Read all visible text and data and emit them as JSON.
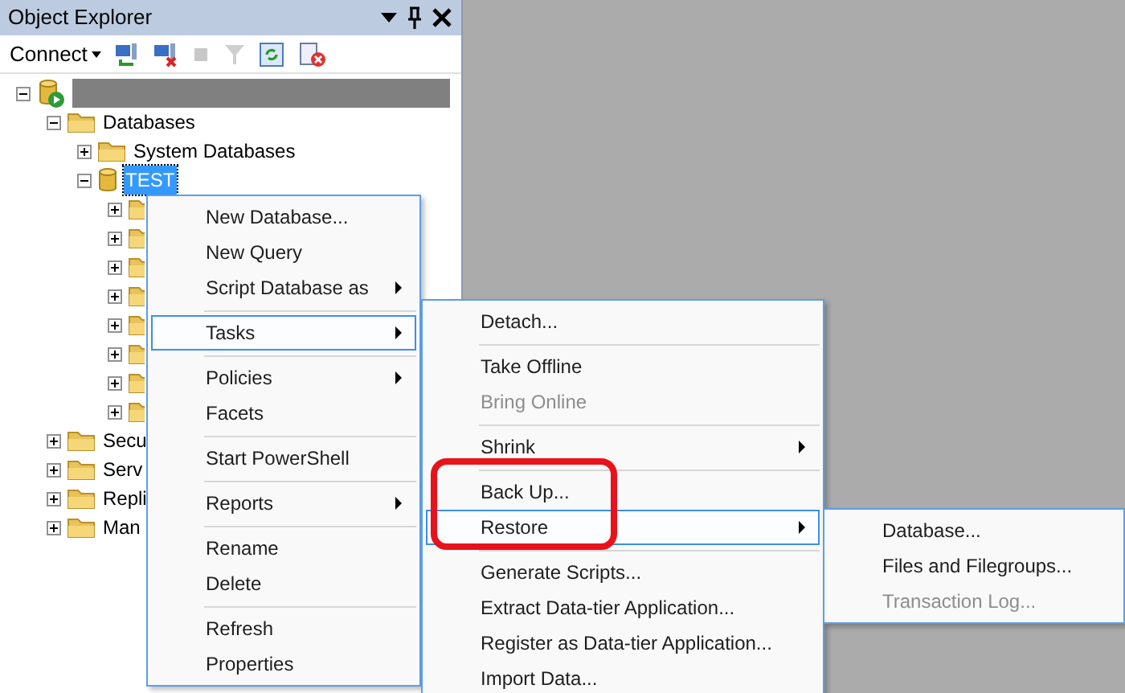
{
  "panel": {
    "title": "Object Explorer",
    "toolbar": {
      "connect": "Connect"
    }
  },
  "tree": [
    {
      "kind": "server",
      "expanded": true,
      "children": [
        {
          "kind": "folder",
          "label": "Databases",
          "expanded": true,
          "children": [
            {
              "kind": "folder",
              "label": "System Databases",
              "expanded": false
            },
            {
              "kind": "database",
              "label": "TEST",
              "expanded": true,
              "selected": true,
              "children": [
                {
                  "kind": "folder",
                  "expanded": false
                },
                {
                  "kind": "folder",
                  "expanded": false
                },
                {
                  "kind": "folder",
                  "expanded": false
                },
                {
                  "kind": "folder",
                  "expanded": false
                },
                {
                  "kind": "folder",
                  "expanded": false
                },
                {
                  "kind": "folder",
                  "expanded": false
                },
                {
                  "kind": "folder",
                  "expanded": false
                },
                {
                  "kind": "folder",
                  "expanded": false
                }
              ]
            }
          ]
        },
        {
          "kind": "folder",
          "label": "Secu",
          "expanded": false
        },
        {
          "kind": "folder",
          "label": "Serv",
          "expanded": false
        },
        {
          "kind": "folder",
          "label": "Repli",
          "expanded": false
        },
        {
          "kind": "folder",
          "label": "Man",
          "expanded": false
        }
      ]
    }
  ],
  "menus": [
    {
      "items": [
        {
          "kind": "item",
          "label": "New Database..."
        },
        {
          "kind": "item",
          "label": "New Query"
        },
        {
          "kind": "item",
          "label": "Script Database as",
          "submenu": true
        },
        {
          "kind": "separator"
        },
        {
          "kind": "item",
          "label": "Tasks",
          "submenu": true,
          "selected": true
        },
        {
          "kind": "separator"
        },
        {
          "kind": "item",
          "label": "Policies",
          "submenu": true
        },
        {
          "kind": "item",
          "label": "Facets"
        },
        {
          "kind": "separator"
        },
        {
          "kind": "item",
          "label": "Start PowerShell"
        },
        {
          "kind": "separator"
        },
        {
          "kind": "item",
          "label": "Reports",
          "submenu": true
        },
        {
          "kind": "separator"
        },
        {
          "kind": "item",
          "label": "Rename"
        },
        {
          "kind": "item",
          "label": "Delete"
        },
        {
          "kind": "separator"
        },
        {
          "kind": "item",
          "label": "Refresh"
        },
        {
          "kind": "item",
          "label": "Properties"
        }
      ]
    },
    {
      "items": [
        {
          "kind": "item",
          "label": "Detach..."
        },
        {
          "kind": "separator"
        },
        {
          "kind": "item",
          "label": "Take Offline"
        },
        {
          "kind": "item",
          "label": "Bring Online",
          "disabled": true
        },
        {
          "kind": "separator"
        },
        {
          "kind": "item",
          "label": "Shrink",
          "submenu": true
        },
        {
          "kind": "separator"
        },
        {
          "kind": "item",
          "label": "Back Up..."
        },
        {
          "kind": "item",
          "label": "Restore",
          "submenu": true,
          "selected": true
        },
        {
          "kind": "separator"
        },
        {
          "kind": "item",
          "label": "Generate Scripts..."
        },
        {
          "kind": "item",
          "label": "Extract Data-tier Application..."
        },
        {
          "kind": "item",
          "label": "Register as Data-tier Application..."
        },
        {
          "kind": "item",
          "label": "Import Data..."
        }
      ]
    },
    {
      "items": [
        {
          "kind": "item",
          "label": "Database..."
        },
        {
          "kind": "item",
          "label": "Files and Filegroups..."
        },
        {
          "kind": "item",
          "label": "Transaction Log...",
          "disabled": true
        }
      ]
    }
  ]
}
